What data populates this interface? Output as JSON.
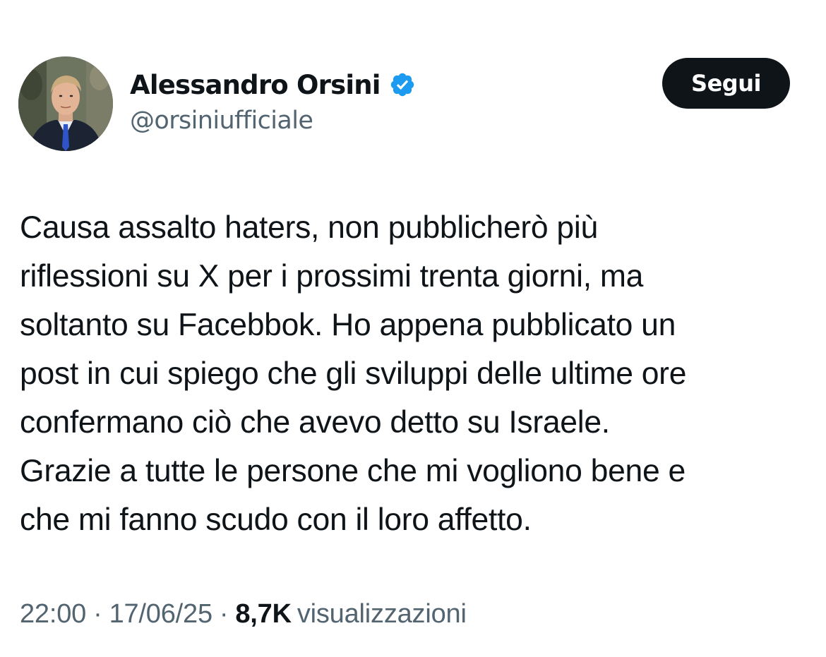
{
  "author": {
    "display_name": "Alessandro Orsini",
    "handle": "@orsiniufficiale",
    "verified": true,
    "verified_icon": "verified-badge-icon",
    "avatar": "profile-photo"
  },
  "follow_button": {
    "label": "Segui"
  },
  "tweet": {
    "text": "Causa assalto haters, non pubblicherò più\nriflessioni su X per i prossimi trenta giorni, ma\nsoltanto su Facebbok. Ho appena pubblicato un\npost in cui spiego che gli sviluppi delle ultime ore\nconfermano ciò che avevo detto su Israele.\nGrazie a tutte le persone che mi vogliono bene e\nche mi fanno scudo con il loro affetto."
  },
  "meta": {
    "time": "22:00",
    "separator": "·",
    "date": "17/06/25",
    "views_count": "8,7K",
    "views_label": "visualizzazioni"
  },
  "colors": {
    "text_primary": "#0f1419",
    "text_secondary": "#536471",
    "verified_blue": "#1d9bf0",
    "button_bg": "#0f1419",
    "button_text": "#ffffff",
    "background": "#ffffff"
  }
}
